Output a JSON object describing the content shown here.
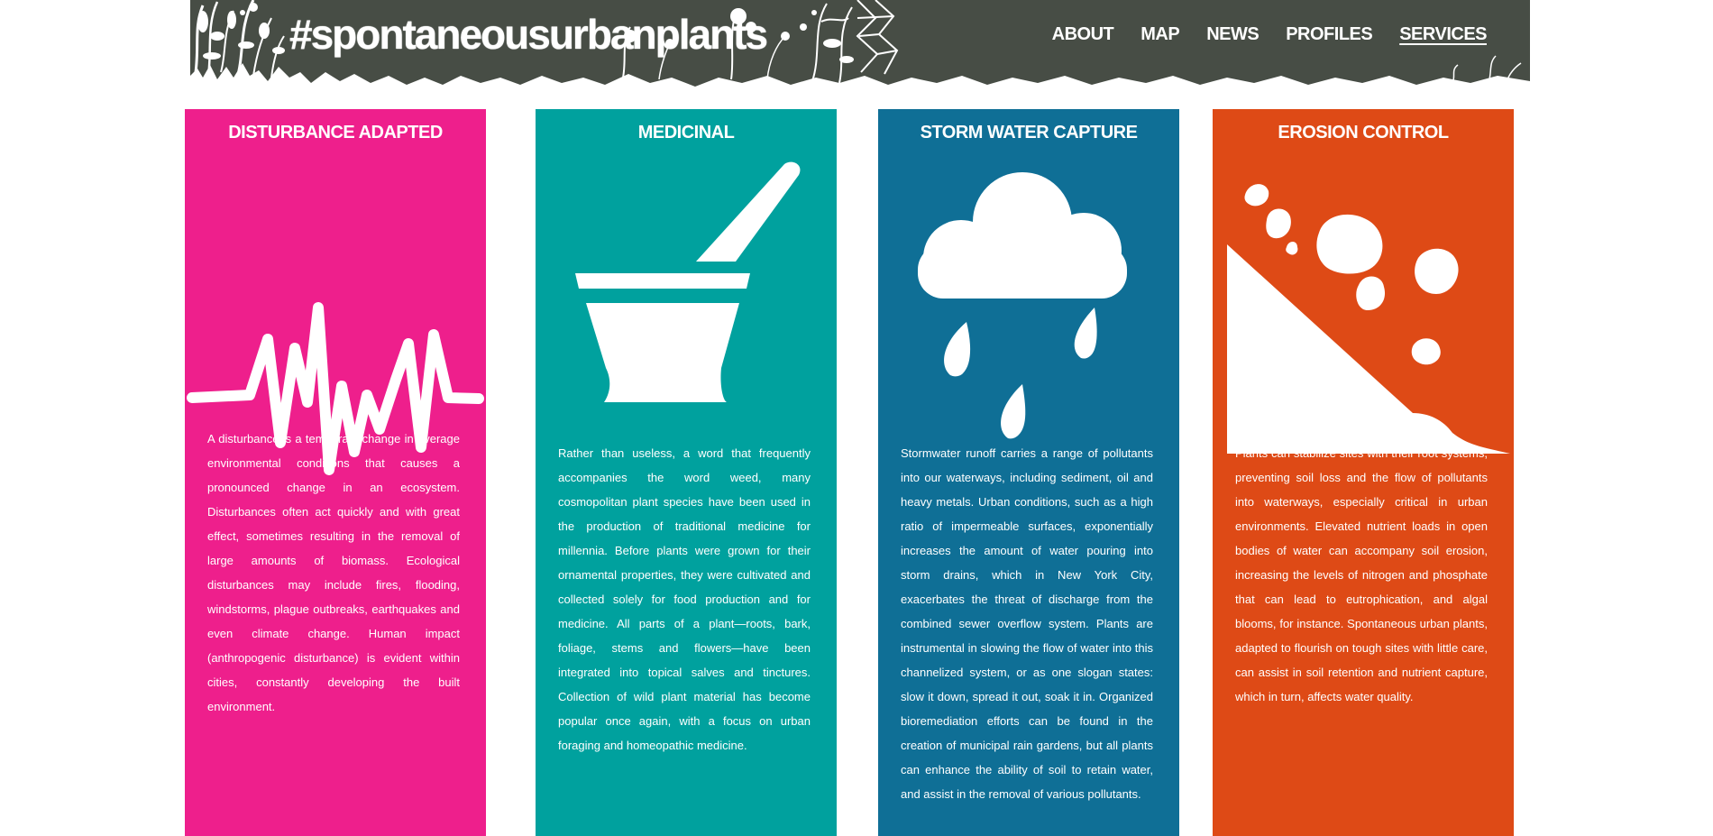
{
  "header": {
    "title": "#spontaneousurbanplants",
    "background_color": "#474d45",
    "nav": [
      {
        "label": "ABOUT",
        "active": false
      },
      {
        "label": "MAP",
        "active": false
      },
      {
        "label": "NEWS",
        "active": false
      },
      {
        "label": "PROFILES",
        "active": false
      },
      {
        "label": "SERVICES",
        "active": true
      }
    ]
  },
  "cards": [
    {
      "title": "DISTURBANCE ADAPTED",
      "color": "#ee1f8c",
      "icon": "heartbeat-icon",
      "text": "A disturbance is a temporary change in average environmental conditions that causes a pronounced change in an ecosystem. Disturbances often act quickly and with great effect, sometimes resulting in the removal of large amounts of biomass. Ecological disturbances may include fires, flooding, windstorms, plague outbreaks, earthquakes and even climate change. Human impact (anthropogenic disturbance) is evident within cities, constantly developing the built environment."
    },
    {
      "title": "MEDICINAL",
      "color": "#00a19e",
      "icon": "mortar-pestle-icon",
      "text": "Rather than useless, a word that frequently accompanies the word weed, many cosmopolitan plant species have been used in the production of traditional medicine for millennia. Before plants were grown for their ornamental properties, they were cultivated and collected solely for food production and for medicine. All parts of a plant—roots, bark, foliage, stems and flowers—have been integrated into topical salves and tinctures. Collection of wild plant material has become popular once again, with a focus on urban foraging and homeopathic medicine."
    },
    {
      "title": "STORM WATER CAPTURE",
      "color": "#0f6f96",
      "icon": "rain-cloud-icon",
      "text": "Stormwater runoff carries a range of pollutants into our waterways, including sediment, oil and heavy metals. Urban conditions, such as a high ratio of impermeable surfaces, exponentially increases the amount of water pouring into storm drains, which in New York City, exacerbates the threat of discharge from the combined sewer overflow system. Plants are instrumental in slowing the flow of water into this channelized system, or as one slogan states: slow it down, spread it out, soak it in. Organized bioremediation efforts can be found in the creation of municipal rain gardens, but all plants can enhance the ability of soil to retain water, and assist in the removal of various pollutants."
    },
    {
      "title": "EROSION CONTROL",
      "color": "#de4a16",
      "icon": "landslide-icon",
      "text": "Plants can stabilize sites with their root systems, preventing soil loss and the flow of pollutants into waterways, especially critical in urban environments. Elevated nutrient loads in open bodies of water can accompany soil erosion, increasing the levels of nitrogen and phosphate that can lead to eutrophication, and algal blooms, for instance. Spontaneous urban plants, adapted to flourish on tough sites with little care, can assist in soil retention and nutrient capture, which in turn, affects water quality."
    }
  ]
}
